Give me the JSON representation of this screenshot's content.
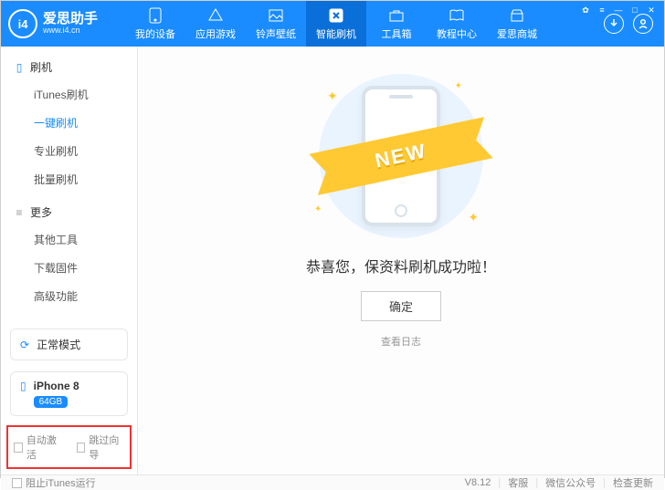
{
  "brand": {
    "logo_text": "i4",
    "name": "爱思助手",
    "url": "www.i4.cn"
  },
  "nav": {
    "items": [
      {
        "label": "我的设备"
      },
      {
        "label": "应用游戏"
      },
      {
        "label": "铃声壁纸"
      },
      {
        "label": "智能刷机"
      },
      {
        "label": "工具箱"
      },
      {
        "label": "教程中心"
      },
      {
        "label": "爱思商城"
      }
    ]
  },
  "sidebar": {
    "group1": {
      "title": "刷机",
      "items": [
        "iTunes刷机",
        "一键刷机",
        "专业刷机",
        "批量刷机"
      ]
    },
    "group2": {
      "title": "更多",
      "items": [
        "其他工具",
        "下载固件",
        "高级功能"
      ]
    },
    "mode": "正常模式",
    "device": {
      "name": "iPhone 8",
      "storage": "64GB"
    },
    "bottom_checks": {
      "a": "自动激活",
      "b": "跳过向导"
    }
  },
  "main": {
    "ribbon": "NEW",
    "message": "恭喜您，保资料刷机成功啦！",
    "ok": "确定",
    "log": "查看日志"
  },
  "status": {
    "block_itunes": "阻止iTunes运行",
    "version": "V8.12",
    "support": "客服",
    "wechat": "微信公众号",
    "update": "检查更新"
  }
}
